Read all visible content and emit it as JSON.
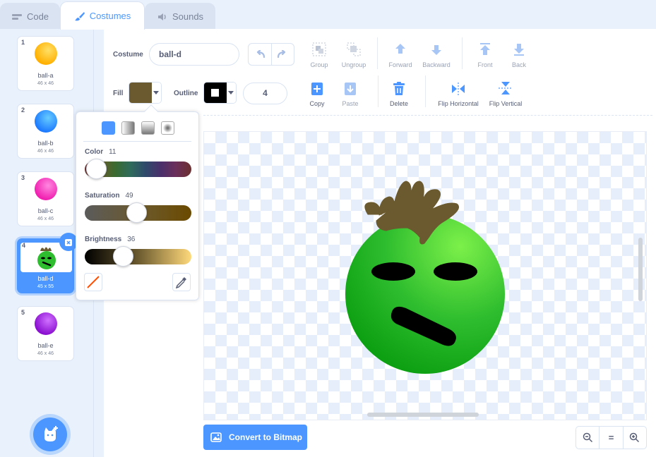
{
  "tabs": [
    {
      "label": "Code",
      "icon": "code-icon"
    },
    {
      "label": "Costumes",
      "icon": "paintbrush-icon",
      "active": true
    },
    {
      "label": "Sounds",
      "icon": "speaker-icon"
    }
  ],
  "costumes": [
    {
      "num": "1",
      "name": "ball-a",
      "size": "46 x 46",
      "color": "#ffab19"
    },
    {
      "num": "2",
      "name": "ball-b",
      "size": "46 x 46",
      "color": "#4c97ff"
    },
    {
      "num": "3",
      "name": "ball-c",
      "size": "46 x 46",
      "color": "#ff3fbf"
    },
    {
      "num": "4",
      "name": "ball-d",
      "size": "45 x 55",
      "color": "#2ebd2e",
      "selected": true
    },
    {
      "num": "5",
      "name": "ball-e",
      "size": "46 x 46",
      "color": "#9b30e0"
    }
  ],
  "toolbar": {
    "costume_label": "Costume",
    "costume_name": "ball-d",
    "group": "Group",
    "ungroup": "Ungroup",
    "forward": "Forward",
    "backward": "Backward",
    "front": "Front",
    "back": "Back",
    "fill_label": "Fill",
    "fill_color": "#6b5a2f",
    "outline_label": "Outline",
    "outline_color": "#000000",
    "outline_width": "4",
    "copy": "Copy",
    "paste": "Paste",
    "delete": "Delete",
    "flip_horizontal": "Flip Horizontal",
    "flip_vertical": "Flip Vertical"
  },
  "fill_popover": {
    "color_label": "Color",
    "color_value": "11",
    "color_level": 0.11,
    "saturation_label": "Saturation",
    "saturation_value": "49",
    "saturation_level": 0.49,
    "brightness_label": "Brightness",
    "brightness_value": "36",
    "brightness_level": 0.36
  },
  "bottom": {
    "convert_label": "Convert to Bitmap",
    "zoom_out": "zoom-out-icon",
    "zoom_reset": "=",
    "zoom_in": "zoom-in-icon"
  },
  "colors": {
    "accent": "#4c97ff",
    "hair": "#6b5a2f",
    "ball_green": "#2ebd2e"
  }
}
